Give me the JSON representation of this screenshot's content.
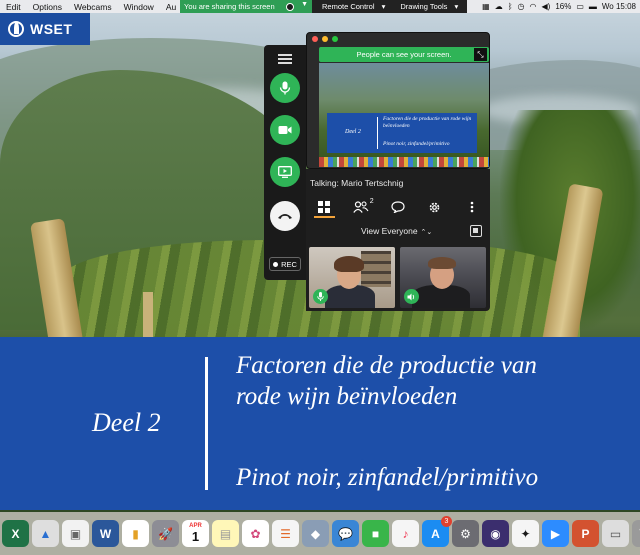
{
  "menubar": {
    "items": [
      "Edit",
      "Options",
      "Webcams",
      "Window",
      "Au"
    ],
    "share_text": "You are sharing this screen",
    "remote_control": "Remote Control",
    "drawing_tools": "Drawing Tools",
    "battery": "16%",
    "clock": "Wo 15:08"
  },
  "logo": {
    "text": "WSET"
  },
  "preview": {
    "notice": "People can see your screen.",
    "thumb_deel": "Deel 2",
    "thumb_title": "Factoren die de productie van rode wijn beïnvloeden",
    "thumb_subtitle": "Pinot noir, zinfandel/primitivo"
  },
  "zoom": {
    "talking": "Talking: Mario Tertschnig",
    "participants_count": "2",
    "view_label": "View Everyone",
    "rec_label": "REC"
  },
  "slide": {
    "deel": "Deel 2",
    "title_line1": "Factoren die de productie van",
    "title_line2": "rode wijn beïnvloeden",
    "subtitle": "Pinot noir, zinfandel/primitivo"
  },
  "dock": {
    "calendar_month": "APR",
    "calendar_day": "1",
    "appstore_badge": "3"
  },
  "colors": {
    "slide_blue": "#1d4fa9",
    "zoom_green": "#2fb457",
    "share_green": "#2f9e55",
    "zoom_dark": "#1e1e1e",
    "active_tab": "#f3a33a"
  }
}
